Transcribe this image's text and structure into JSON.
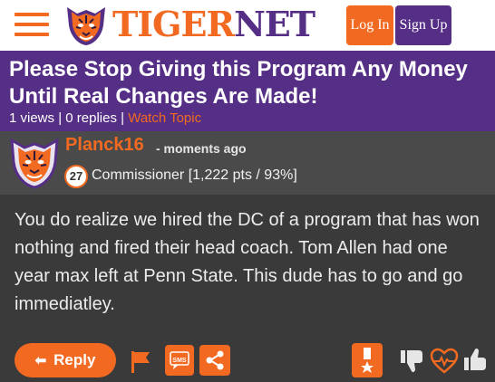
{
  "header": {
    "brand_tiger": "TIGER",
    "brand_net": "NET",
    "login_label": "Log In",
    "signup_label": "Sign Up"
  },
  "topic": {
    "title": "Please Stop Giving this Program Any Money Until Real Changes Are Made!",
    "views": "1 views",
    "replies": "0 replies",
    "separator": "|",
    "watch_label": "Watch Topic"
  },
  "post": {
    "username": "Planck16",
    "timestamp": "- moments ago",
    "level": "27",
    "rank": "Commissioner [1,222 pts / 93%]",
    "body": "You do realize we hired the DC of a program that has won nothing and fired their head coach. Tom Allen had one year max left at Penn State. This dude has to go and go immediatley."
  },
  "actions": {
    "reply_label": "Reply",
    "sms_label": "SMS"
  },
  "colors": {
    "orange": "#f26a21",
    "purple": "#552e86",
    "background": "#3a3a3a"
  },
  "icons": [
    "menu-icon",
    "tiger-logo",
    "reply-arrow-icon",
    "flag-icon",
    "sms-icon",
    "share-icon",
    "medal-icon",
    "thumbs-down-icon",
    "heartbeat-icon",
    "thumbs-up-icon"
  ]
}
